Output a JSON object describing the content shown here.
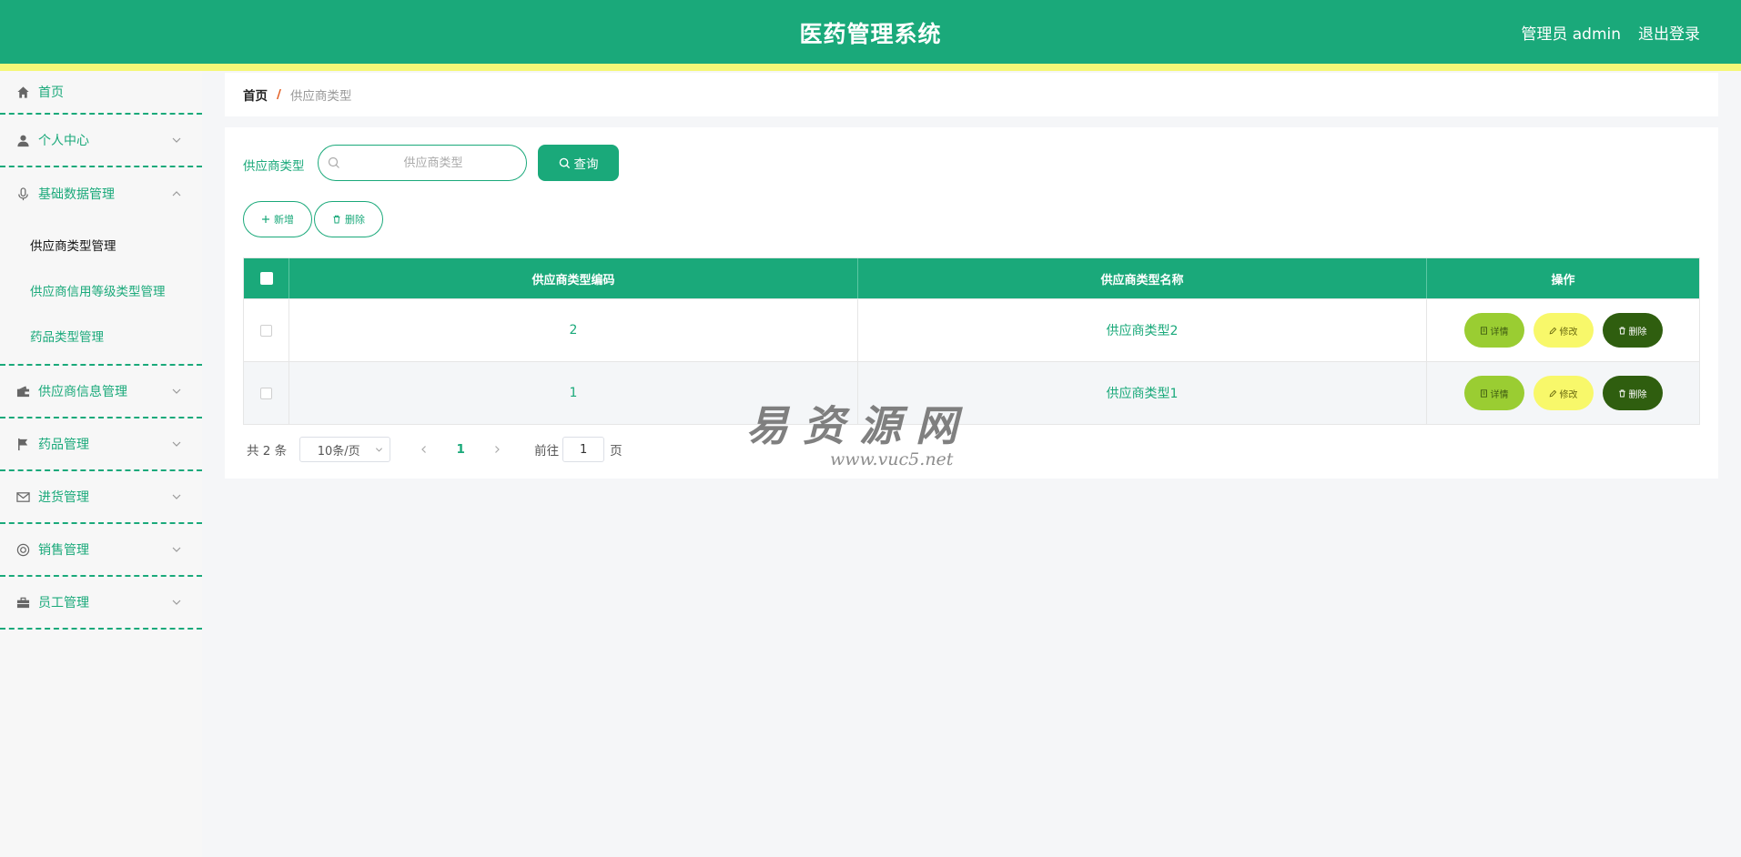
{
  "header": {
    "title": "医药管理系统",
    "user": "管理员 admin",
    "logout": "退出登录"
  },
  "sidebar": {
    "items": [
      {
        "label": "首页",
        "icon": "home-icon"
      },
      {
        "label": "个人中心",
        "icon": "user-icon"
      },
      {
        "label": "基础数据管理",
        "icon": "microphone-icon",
        "expanded": true,
        "children": [
          "供应商类型管理",
          "供应商信用等级类型管理",
          "药品类型管理"
        ]
      },
      {
        "label": "供应商信息管理",
        "icon": "wallet-icon"
      },
      {
        "label": "药品管理",
        "icon": "flag-icon"
      },
      {
        "label": "进货管理",
        "icon": "mail-icon"
      },
      {
        "label": "销售管理",
        "icon": "lifebuoy-icon"
      },
      {
        "label": "员工管理",
        "icon": "briefcase-icon"
      }
    ],
    "active_child": "供应商类型管理"
  },
  "breadcrumb": {
    "home": "首页",
    "separator": "/",
    "current": "供应商类型"
  },
  "search": {
    "label": "供应商类型",
    "placeholder": "供应商类型",
    "value": "",
    "button": "查询"
  },
  "actions": {
    "add": "新增",
    "delete": "删除"
  },
  "table": {
    "columns": [
      "供应商类型编码",
      "供应商类型名称",
      "操作"
    ],
    "rows": [
      {
        "code": "2",
        "name": "供应商类型2"
      },
      {
        "code": "1",
        "name": "供应商类型1"
      }
    ],
    "ops": {
      "detail": "详情",
      "edit": "修改",
      "delete": "删除"
    }
  },
  "pagination": {
    "total": "共 2 条",
    "page_size": "10条/页",
    "current_page": "1",
    "goto_label": "前往",
    "goto_value": "1",
    "goto_unit": "页"
  },
  "watermark": {
    "main": "易资源网",
    "sub": "www.vuc5.net"
  },
  "colors": {
    "primary": "#1aa97a",
    "stripe": "#f5f778",
    "detail": "#9acd32",
    "edit": "#f8f86a",
    "delete": "#2f5e0f",
    "breadcrumb_sep": "#e25a1c"
  }
}
